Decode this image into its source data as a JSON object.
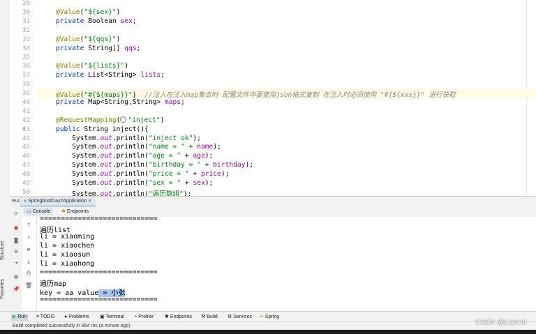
{
  "left_strip": {
    "structure_label": "Structure",
    "favorites_label": "Favorites"
  },
  "editor": {
    "lines": [
      {
        "n": "29",
        "html": ""
      },
      {
        "n": "30",
        "html": "<span class='ann'>@Value</span>(<span class='str'>\"${sex}\"</span>)"
      },
      {
        "n": "31",
        "html": "<span class='kw'>private</span> Boolean <span class='fld'>sex</span>;"
      },
      {
        "n": "32",
        "html": ""
      },
      {
        "n": "33",
        "html": "<span class='ann'>@Value</span>(<span class='str'>\"${qqs}\"</span>)"
      },
      {
        "n": "34",
        "html": "<span class='kw'>private</span> String[] <span class='fld'>qqs</span>;"
      },
      {
        "n": "35",
        "html": ""
      },
      {
        "n": "36",
        "html": "<span class='ann'>@Value</span>(<span class='str'>\"${lists}\"</span>)"
      },
      {
        "n": "37",
        "html": "<span class='kw'>private</span> List&lt;String&gt; <span class='fld'>lists</span>;"
      },
      {
        "n": "38",
        "html": ""
      },
      {
        "n": "39",
        "html": "<span class='ann'>@Value</span>(<span class='str'>\"#{${maps}}\"</span>)  <span class='cmt'>//注入在注入map集合时 配置文件中要使用json格式复制 在注入时必须使用 \"#{${xxx}}\" 进行获取</span>"
      },
      {
        "n": "40",
        "html": "<span class='kw'>private</span> Map&lt;String,String&gt; <span class='fld'>maps</span>;"
      },
      {
        "n": "41",
        "html": ""
      },
      {
        "n": "42",
        "html": "<span class='ann'>@RequestMapping</span>(<span class='ic-inline'></span><span class='str'>\"inject\"</span>)"
      },
      {
        "n": "43",
        "html": "<span class='kw'>public</span> String inject(){"
      },
      {
        "n": "44",
        "html": "    System.<span class='itl'>out</span>.println(<span class='str'>\"inject ok\"</span>);"
      },
      {
        "n": "45",
        "html": "    System.<span class='itl'>out</span>.println(<span class='str'>\"name = \"</span> + <span class='fld'>name</span>);"
      },
      {
        "n": "46",
        "html": "    System.<span class='itl'>out</span>.println(<span class='str'>\"age = \"</span> + <span class='fld'>age</span>);"
      },
      {
        "n": "47",
        "html": "    System.<span class='itl'>out</span>.println(<span class='str'>\"birthday = \"</span> + <span class='fld'>birthday</span>);"
      },
      {
        "n": "48",
        "html": "    System.<span class='itl'>out</span>.println(<span class='str'>\"price = \"</span> + <span class='fld'>price</span>);"
      },
      {
        "n": "49",
        "html": "    System.<span class='itl'>out</span>.println(<span class='str'>\"sex = \"</span> + <span class='fld'>sex</span>);"
      },
      {
        "n": "50",
        "html": "    System.<span class='itl'>out</span>.println(<span class='str'>\"遍历数组\"</span>);"
      }
    ]
  },
  "run_bar": {
    "label": "Run:",
    "config_name": "SpringbootDay2Application"
  },
  "console_tabs": {
    "console": "Console",
    "endpoints": "Endpoints"
  },
  "console": {
    "lines": [
      "============================",
      "遍历list",
      "li = xiaoming",
      "li = xiaochen",
      "li = xiaosun",
      "li = xiaohong",
      "============================",
      "遍历map",
      "key = aa value = 小张",
      "============================"
    ]
  },
  "bottom_tools": {
    "run": "Run",
    "todo": "TODO",
    "problems": "Problems",
    "terminal": "Terminal",
    "profiler": "Profiler",
    "endpoints": "Endpoints",
    "build": "Build",
    "services": "Services",
    "spring": "Spring"
  },
  "status": {
    "message": "Build completed successfully in 964 ms (a minute ago)"
  },
  "watermark": "CSDN @Lzysnd"
}
